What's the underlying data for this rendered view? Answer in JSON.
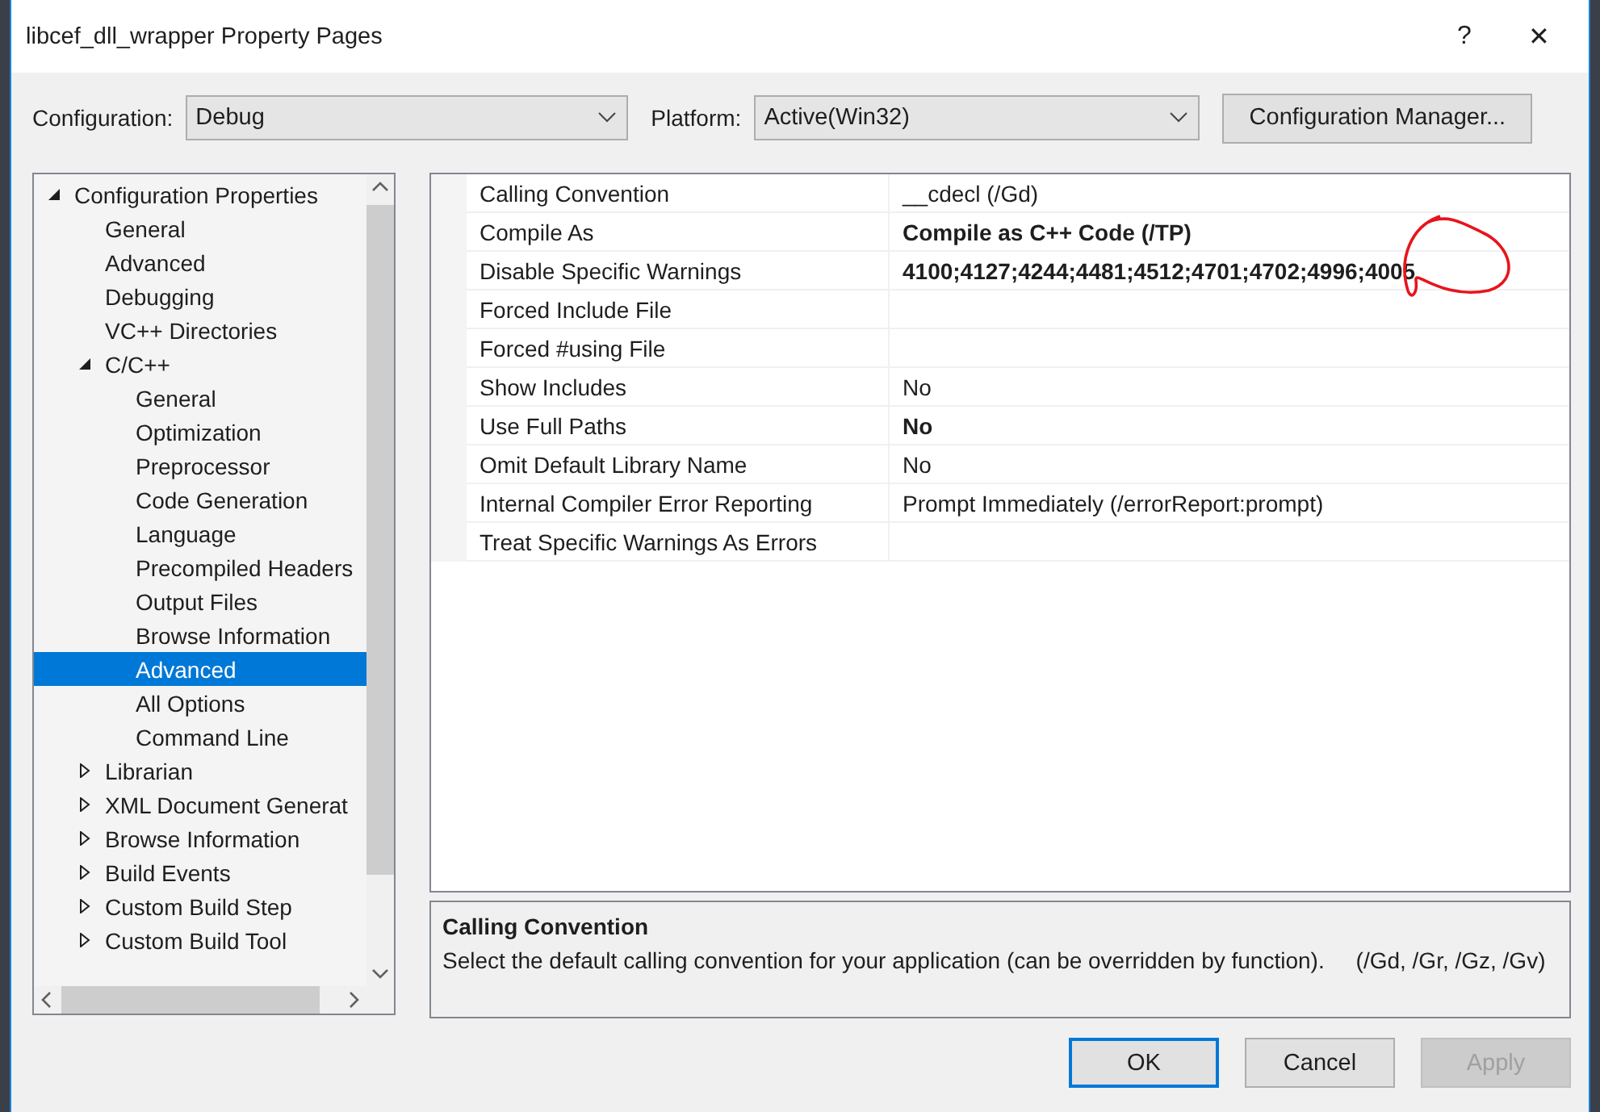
{
  "window": {
    "title": "libcef_dll_wrapper Property Pages",
    "help": "?",
    "close": "✕"
  },
  "configuration": {
    "label": "Configuration:",
    "value": "Debug"
  },
  "platform": {
    "label": "Platform:",
    "value": "Active(Win32)"
  },
  "configuration_manager": "Configuration Manager...",
  "tree": [
    {
      "label": "Configuration Properties",
      "expanded": true,
      "selected": false,
      "children": [
        {
          "label": "General",
          "selected": false
        },
        {
          "label": "Advanced",
          "selected": false
        },
        {
          "label": "Debugging",
          "selected": false
        },
        {
          "label": "VC++ Directories",
          "selected": false
        },
        {
          "label": "C/C++",
          "expanded": true,
          "selected": false,
          "children": [
            {
              "label": "General",
              "selected": false
            },
            {
              "label": "Optimization",
              "selected": false
            },
            {
              "label": "Preprocessor",
              "selected": false
            },
            {
              "label": "Code Generation",
              "selected": false
            },
            {
              "label": "Language",
              "selected": false
            },
            {
              "label": "Precompiled Headers",
              "selected": false
            },
            {
              "label": "Output Files",
              "selected": false
            },
            {
              "label": "Browse Information",
              "selected": false
            },
            {
              "label": "Advanced",
              "selected": true
            },
            {
              "label": "All Options",
              "selected": false
            },
            {
              "label": "Command Line",
              "selected": false
            }
          ]
        },
        {
          "label": "Librarian",
          "expanded": false,
          "selected": false
        },
        {
          "label": "XML Document Generat",
          "expanded": false,
          "selected": false
        },
        {
          "label": "Browse Information",
          "expanded": false,
          "selected": false
        },
        {
          "label": "Build Events",
          "expanded": false,
          "selected": false
        },
        {
          "label": "Custom Build Step",
          "expanded": false,
          "selected": false
        },
        {
          "label": "Custom Build Tool",
          "expanded": false,
          "selected": false
        }
      ]
    }
  ],
  "properties": [
    {
      "name": "Calling Convention",
      "value": "__cdecl (/Gd)",
      "modified": false
    },
    {
      "name": "Compile As",
      "value": "Compile as C++ Code (/TP)",
      "modified": true
    },
    {
      "name": "Disable Specific Warnings",
      "value": "4100;4127;4244;4481;4512;4701;4702;4996;4005",
      "modified": true
    },
    {
      "name": "Forced Include File"
    },
    {
      "name": "Forced #using File"
    },
    {
      "name": "Show Includes",
      "value": "No",
      "modified": false
    },
    {
      "name": "Use Full Paths",
      "value": "No",
      "modified": true
    },
    {
      "name": "Omit Default Library Name",
      "value": "No",
      "modified": false
    },
    {
      "name": "Internal Compiler Error Reporting",
      "value": "Prompt Immediately (/errorReport:prompt)",
      "modified": false
    },
    {
      "name": "Treat Specific Warnings As Errors"
    }
  ],
  "description": {
    "title": "Calling Convention",
    "text": "Select the default calling convention for your application (can be overridden by function).     (/Gd, /Gr, /Gz, /Gv)"
  },
  "buttons": [
    {
      "label": "OK",
      "default": true,
      "disabled": false
    },
    {
      "label": "Cancel",
      "default": false,
      "disabled": false
    },
    {
      "label": "Apply",
      "default": false,
      "disabled": true
    }
  ]
}
